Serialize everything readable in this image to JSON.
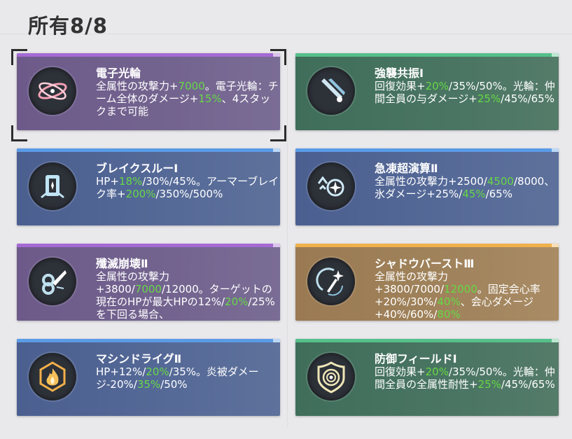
{
  "header": {
    "title": "所有8/8"
  },
  "cards": [
    {
      "title": "電子光輪",
      "desc": [
        {
          "t": "全属性の攻撃力+"
        },
        {
          "t": "7000",
          "g": true
        },
        {
          "t": "。電子光輪：チーム全体のダメージ+"
        },
        {
          "t": "15%",
          "g": true
        },
        {
          "t": "、4スタックまで可能"
        }
      ]
    },
    {
      "title": "強襲共振Ⅰ",
      "desc": [
        {
          "t": "回復効果+"
        },
        {
          "t": "20%",
          "g": true
        },
        {
          "t": "/35%/50%。光輪：仲間全員の与ダメージ+"
        },
        {
          "t": "25%",
          "g": true
        },
        {
          "t": "/45%/65%"
        }
      ]
    },
    {
      "title": "ブレイクスルーⅠ",
      "desc": [
        {
          "t": "HP+"
        },
        {
          "t": "18%",
          "g": true
        },
        {
          "t": "/30%/45%。アーマーブレイク率+"
        },
        {
          "t": "200%",
          "g": true
        },
        {
          "t": "/350%/500%"
        }
      ]
    },
    {
      "title": "急凍超演算Ⅱ",
      "desc": [
        {
          "t": "全属性の攻撃力+2500/"
        },
        {
          "t": "4500",
          "g": true
        },
        {
          "t": "/8000、氷ダメージ+25%/"
        },
        {
          "t": "45%",
          "g": true
        },
        {
          "t": "/65%"
        }
      ]
    },
    {
      "title": "殲滅崩壊Ⅱ",
      "desc": [
        {
          "t": "全属性の攻撃力+3800/"
        },
        {
          "t": "7000",
          "g": true
        },
        {
          "t": "/12000。ターゲットの現在のHPが最大HPの12%/"
        },
        {
          "t": "20%",
          "g": true
        },
        {
          "t": "/25%を下回る場合、"
        }
      ]
    },
    {
      "title": "シャドウバーストⅢ",
      "desc": [
        {
          "t": "全属性の攻撃力+3800/7000/"
        },
        {
          "t": "12000",
          "g": true
        },
        {
          "t": "。固定会心率+20%/30%/"
        },
        {
          "t": "40%",
          "g": true
        },
        {
          "t": "、会心ダメージ+40%/60%/"
        },
        {
          "t": "80%",
          "g": true
        }
      ]
    },
    {
      "title": "マシンドライグⅡ",
      "desc": [
        {
          "t": "HP+12%/"
        },
        {
          "t": "20%",
          "g": true
        },
        {
          "t": "/35%。炎被ダメージ-20%/"
        },
        {
          "t": "35%",
          "g": true
        },
        {
          "t": "/50%"
        }
      ]
    },
    {
      "title": "防御フィールドⅠ",
      "desc": [
        {
          "t": "回復効果+"
        },
        {
          "t": "20%",
          "g": true
        },
        {
          "t": "/35%/50%。光輪：仲間全員の全属性耐性+"
        },
        {
          "t": "25%",
          "g": true
        },
        {
          "t": "/45%/65%"
        }
      ]
    }
  ],
  "colors": {
    "purple": "#a56ad4",
    "blue": "#5a9be6",
    "green": "#55c08a",
    "orange": "#f0b04a",
    "highlight": "#66d944"
  },
  "icons": [
    "electron-ring-icon",
    "assault-blade-icon",
    "breakthrough-icon",
    "frost-compute-icon",
    "annihilation-icon",
    "shadow-burst-icon",
    "machine-flame-icon",
    "defense-field-icon"
  ]
}
